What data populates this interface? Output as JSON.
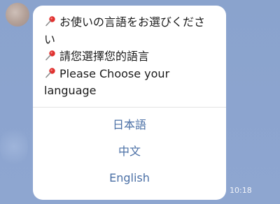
{
  "message": {
    "lines": [
      {
        "icon": "pushpin-icon",
        "text": "お使いの言語をお選びくださ"
      },
      {
        "icon": "",
        "text": "い"
      },
      {
        "icon": "pushpin-icon",
        "text": "請您選擇您的語言"
      },
      {
        "icon": "pushpin-icon",
        "text": "Please Choose your"
      },
      {
        "icon": "",
        "text": "language"
      }
    ]
  },
  "options": [
    {
      "label": "日本語"
    },
    {
      "label": "中文"
    },
    {
      "label": "English"
    }
  ],
  "timestamp": "10:18",
  "colors": {
    "chat_background": "#8ba3ce",
    "bubble": "#ffffff",
    "option_text": "#4a6fa5",
    "pin": "#e0312f"
  }
}
